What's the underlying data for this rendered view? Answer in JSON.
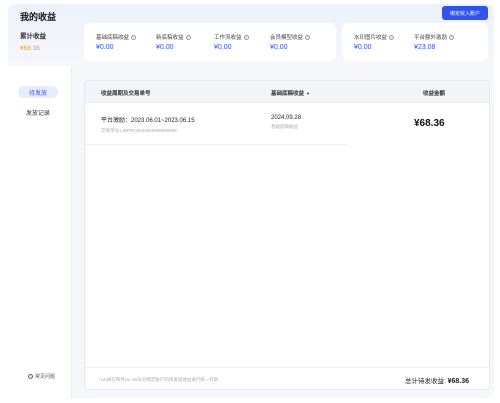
{
  "header": {
    "title": "我的收益",
    "bind_button": "绑定收入账户"
  },
  "summary": {
    "cumulative_label": "累计收益",
    "cumulative_value": "¥68.36"
  },
  "metrics_group1": [
    {
      "label": "基础底稿收益",
      "value": "¥0.00"
    },
    {
      "label": "新底稿收益",
      "value": "¥0.00"
    },
    {
      "label": "工作流收益",
      "value": "¥0.00"
    },
    {
      "label": "会员模型收益",
      "value": "¥0.00"
    }
  ],
  "metrics_group2": [
    {
      "label": "水印图片收益",
      "value": "¥0.00"
    },
    {
      "label": "平台额外激励",
      "value": "¥23.08"
    }
  ],
  "sidebar": {
    "items": [
      {
        "label": "待发放"
      },
      {
        "label": "发放记录"
      }
    ],
    "faq": "常见问题"
  },
  "table": {
    "headers": {
      "period": "收益周期及交易单号",
      "type": "基础底稿收益",
      "amount": "收益金额"
    },
    "rows": [
      {
        "period": "平台激励：2023.06.01~2023.06.15",
        "txn": "交易单号:LIBPRO2023069999999999",
        "date": "2024.09.28",
        "type_sub": "基础底稿收益",
        "amount": "¥68.36"
      }
    ]
  },
  "footer": {
    "note": "*Lib将在每月15~20号对绑定账户的待发放收益进行统一打款",
    "total_label": "总计待发收益:",
    "total_value": "¥68.36"
  },
  "colors": {
    "accent": "#2f54eb",
    "cumulative": "#f0a030"
  }
}
